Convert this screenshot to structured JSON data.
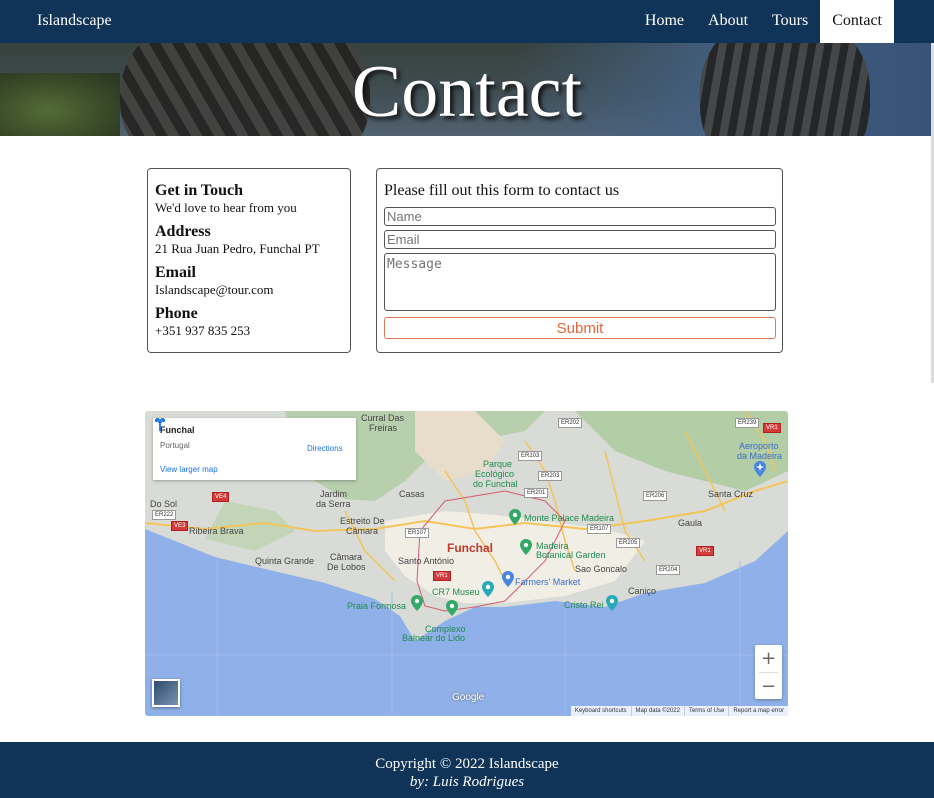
{
  "nav": {
    "brand": "Islandscape",
    "links": [
      {
        "label": "Home",
        "active": false
      },
      {
        "label": "About",
        "active": false
      },
      {
        "label": "Tours",
        "active": false
      },
      {
        "label": "Contact",
        "active": true
      }
    ]
  },
  "hero": {
    "title": "Contact"
  },
  "info": {
    "heading": "Get in Touch",
    "subheading": "We'd love to hear from you",
    "address_heading": "Address",
    "address": "21 Rua Juan Pedro, Funchal PT",
    "email_heading": "Email",
    "email": "Islandscape@tour.com",
    "phone_heading": "Phone",
    "phone": "+351 937 835 253"
  },
  "form": {
    "title": "Please fill out this form to contact us",
    "name_placeholder": "Name",
    "email_placeholder": "Email",
    "message_placeholder": "Message",
    "submit_label": "Submit",
    "submit_color": "#e0663a"
  },
  "map": {
    "popup": {
      "place": "Funchal",
      "country": "Portugal",
      "larger_map": "View larger map",
      "directions": "Directions"
    },
    "labels": {
      "curral": "Curral Das",
      "freiras": "Freiras",
      "parque1": "Parque",
      "parque2": "Ecológico",
      "parque3": "do Funchal",
      "aeroporto1": "Aeroporto",
      "aeroporto2": "da Madeira",
      "dosol": "Do Sol",
      "jardim1": "Jardim",
      "jardim2": "da Serra",
      "casas": "Casas",
      "santacruz": "Santa Cruz",
      "ribeira": "Ribeira Brava",
      "estreito1": "Estreito De",
      "estreito2": "Câmara",
      "monte": "Monte Palace Madeira",
      "gaula": "Gaula",
      "funchal": "Funchal",
      "botanical1": "Madeira",
      "botanical2": "Botanical Garden",
      "quinta": "Quinta Grande",
      "camara1": "Câmara",
      "camara2": "De Lobos",
      "santoantonio": "Santo António",
      "saogoncalo": "Sao Goncalo",
      "farmers": "Farmers' Market",
      "canico": "Caniço",
      "cr7": "CR7 Museu",
      "praia": "Praia Formosa",
      "cristo": "Cristo Rei",
      "complexo1": "Complexo",
      "complexo2": "Balnear do Lido"
    },
    "roads": {
      "er202": "ER202",
      "er239": "ER239",
      "vr1": "VR1",
      "er103": "ER103",
      "er203": "ER203",
      "er201": "ER201",
      "er206": "ER206",
      "ve4": "VE4",
      "er222": "ER222",
      "ve3": "VE3",
      "er107": "ER107",
      "er205": "ER205",
      "er204": "ER204"
    },
    "zoom_in": "+",
    "zoom_out": "−",
    "google": "Google",
    "attribution": [
      "Keyboard shortcuts",
      "Map data ©2022",
      "Terms of Use",
      "Report a map error"
    ]
  },
  "footer": {
    "copyright": "Copyright © 2022 Islandscape",
    "author": "by: Luis Rodrigues"
  },
  "colors": {
    "nav_bg": "#0f3458",
    "sea": "#8fb0e8",
    "land": "#d9dcd6",
    "forest": "#a9c49b",
    "urban": "#f1eee6"
  },
  "icons": [
    "directions-icon",
    "layers-icon",
    "zoom-in-icon",
    "zoom-out-icon",
    "map-pin-icon",
    "airport-icon"
  ]
}
